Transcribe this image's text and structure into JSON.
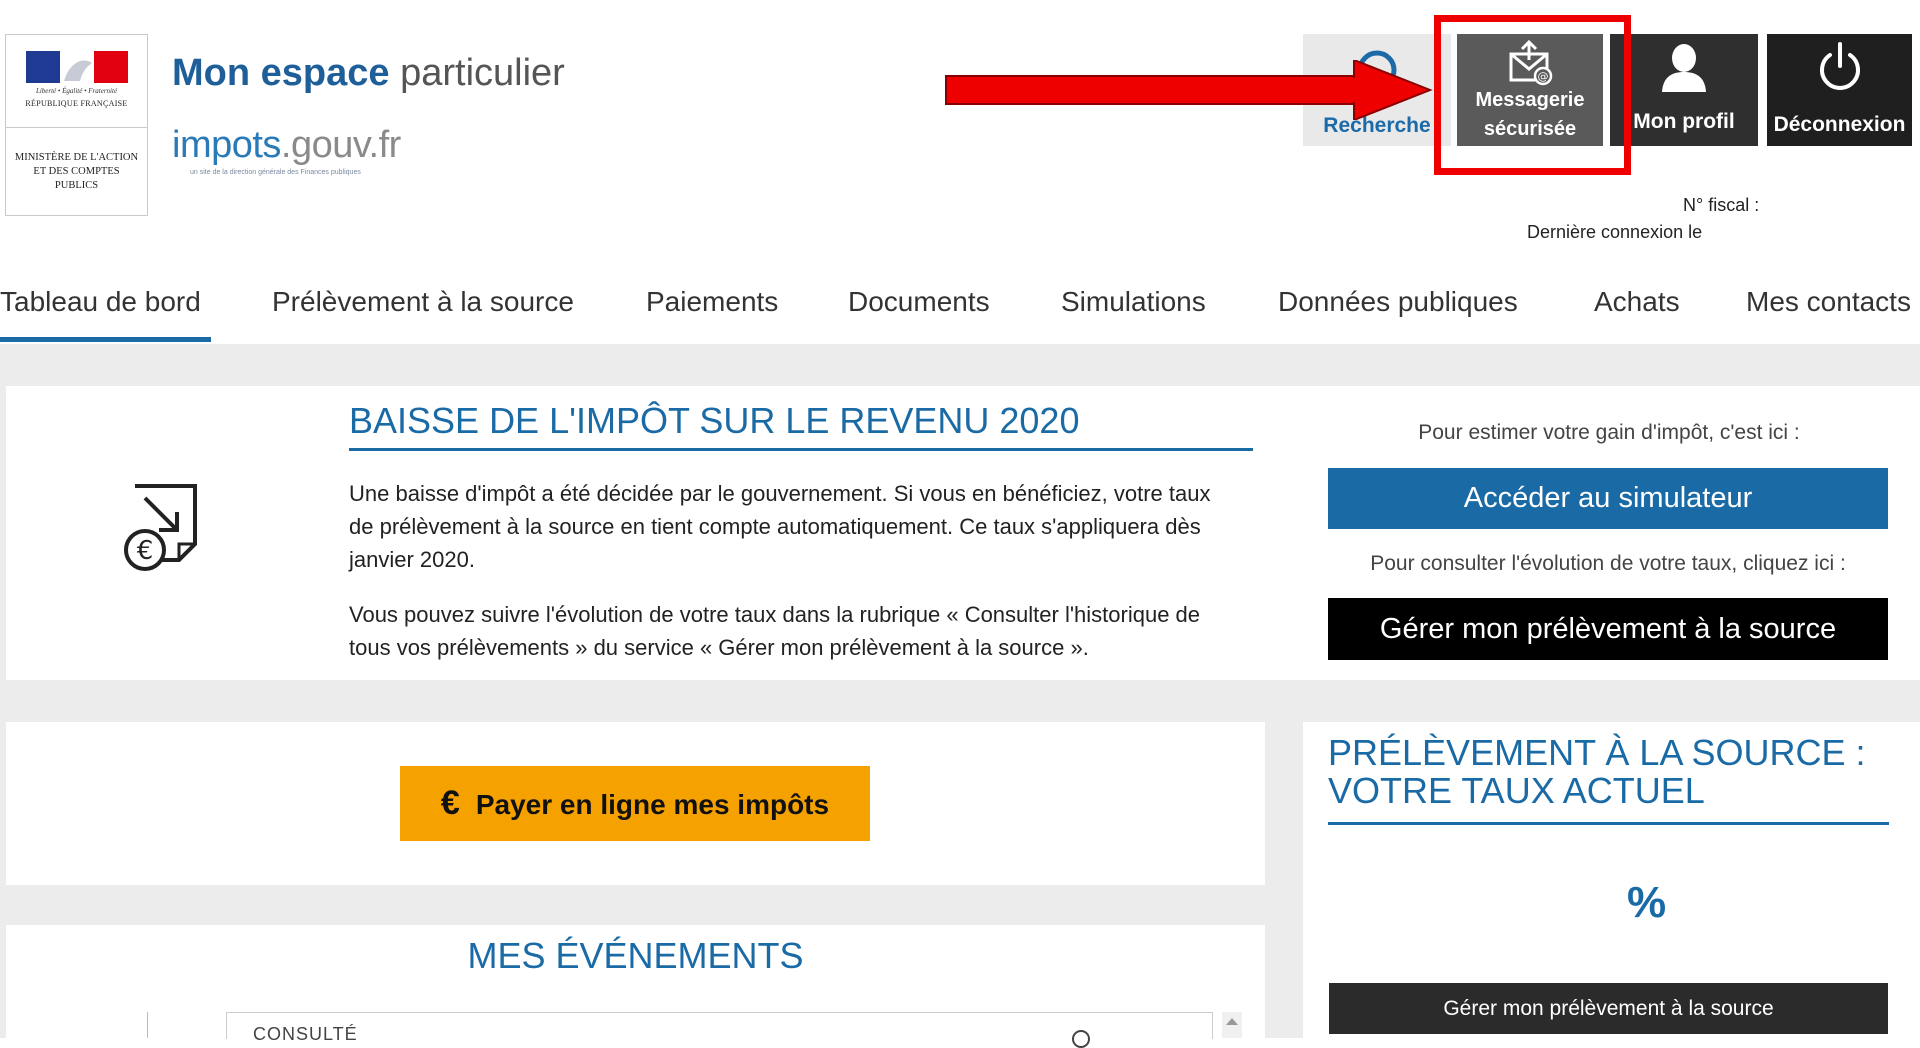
{
  "header": {
    "logo": {
      "motto": "Liberté • Égalité • Fraternité",
      "republique": "RÉPUBLIQUE FRANÇAISE",
      "ministere": "MINISTÈRE DE L'ACTION ET DES COMPTES PUBLICS"
    },
    "site_title_bold": "Mon espace",
    "site_title_light": "particulier",
    "impots_main": "impots",
    "impots_suffix": ".gouv.fr",
    "impots_tagline": "un site de la direction générale des Finances publiques",
    "actions": {
      "recherche": "Recherche",
      "messagerie_line1": "Messagerie",
      "messagerie_line2": "sécurisée",
      "profil": "Mon profil",
      "deconnexion": "Déconnexion"
    },
    "fiscal_label": "N° fiscal :",
    "derniere_connexion_label": "Dernière connexion le"
  },
  "nav": {
    "tabs": [
      {
        "label": "Tableau de bord",
        "active": true
      },
      {
        "label": "Prélèvement à la source",
        "active": false
      },
      {
        "label": "Paiements",
        "active": false
      },
      {
        "label": "Documents",
        "active": false
      },
      {
        "label": "Simulations",
        "active": false
      },
      {
        "label": "Données publiques",
        "active": false
      },
      {
        "label": "Achats",
        "active": false
      },
      {
        "label": "Mes contacts",
        "active": false
      }
    ]
  },
  "baisse": {
    "title": "BAISSE DE L'IMPÔT SUR LE REVENU 2020",
    "paragraph1": "Une baisse d'impôt a été décidée par le gouvernement. Si vous en bénéficiez, votre taux de prélèvement à la source en tient compte automatiquement. Ce taux s'appliquera dès janvier 2020.",
    "paragraph2": "Vous pouvez suivre l'évolution de votre taux dans la rubrique « Consulter l'historique de tous vos prélèvements » du service « Gérer mon prélèvement à la source »."
  },
  "simulateur": {
    "estimer_text": "Pour estimer votre gain d'impôt, c'est ici :",
    "button_label": "Accéder au simulateur",
    "consulter_text": "Pour consulter l'évolution de votre taux, cliquez ici :",
    "gerer_button_label": "Gérer mon prélèvement à la source"
  },
  "payer": {
    "euro_symbol": "€",
    "button_label": "Payer en ligne mes impôts"
  },
  "evenements": {
    "title": "MES ÉVÉNEMENTS",
    "first_item": "CONSULTÉ"
  },
  "taux": {
    "title": "PRÉLÈVEMENT À LA SOURCE : VOTRE TAUX ACTUEL",
    "percent": "%",
    "button_label": "Gérer mon prélèvement à la source"
  },
  "colors": {
    "primary_blue": "#1a6aa6",
    "highlight_red": "#ee0000",
    "payer_orange": "#f5a100"
  }
}
